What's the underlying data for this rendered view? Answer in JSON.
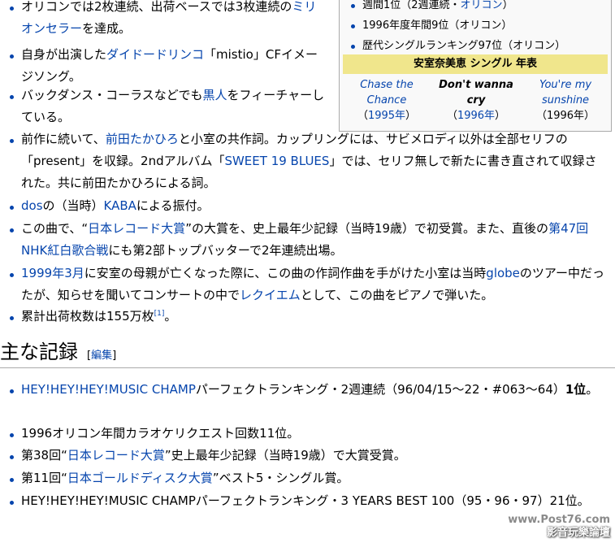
{
  "top_list": [
    {
      "parts": [
        {
          "t": "オリコンでは2枚連続、出荷ベースでは3枚連続の"
        },
        {
          "t": "ミリオンセラー",
          "link": true
        },
        {
          "t": "を達成。"
        }
      ]
    },
    {
      "parts": [
        {
          "t": "自身が出演した"
        },
        {
          "t": "ダイドードリンコ",
          "link": true
        },
        {
          "t": "「mistio」CFイメージソング。"
        }
      ]
    },
    {
      "parts": [
        {
          "t": "バックダンス・コーラスなどでも"
        },
        {
          "t": "黒人",
          "link": true
        },
        {
          "t": "をフィーチャーしている。"
        }
      ]
    },
    {
      "parts": [
        {
          "t": "前作に続いて、"
        },
        {
          "t": "前田たかひろ",
          "link": true
        },
        {
          "t": "と小室の共作詞。カップリングには、サビメロディ以外は全部セリフの「present」を収録。2ndアルバム「"
        },
        {
          "t": "SWEET 19 BLUES",
          "link": true
        },
        {
          "t": "」では、セリフ無しで新たに書き直されて収録された。共に前田たかひろによる詞。"
        }
      ]
    },
    {
      "parts": [
        {
          "t": "dos",
          "link": true
        },
        {
          "t": "の（当時）"
        },
        {
          "t": "KABA",
          "link": true
        },
        {
          "t": "による振付。"
        }
      ]
    },
    {
      "parts": [
        {
          "t": "この曲で、“"
        },
        {
          "t": "日本レコード大賞",
          "link": true
        },
        {
          "t": "”の大賞を、史上最年少記録（当時19歳）で初受賞。また、直後の"
        },
        {
          "t": "第47回NHK紅白歌合戦",
          "link": true
        },
        {
          "t": "にも第2部トップバッターで2年連続出場。"
        }
      ]
    },
    {
      "parts": [
        {
          "t": "1999年",
          "link": true
        },
        {
          "t": "3月",
          "link": true
        },
        {
          "t": "に安室の母親が亡くなった際に、この曲の作詞作曲を手がけた小室は当時"
        },
        {
          "t": "globe",
          "link": true
        },
        {
          "t": "のツアー中だったが、知らせを聞いてコンサートの中で"
        },
        {
          "t": "レクイエム",
          "link": true
        },
        {
          "t": "として、この曲をピアノで弾いた。"
        }
      ]
    },
    {
      "parts": [
        {
          "t": "累計出荷枚数は155万枚"
        },
        {
          "t": "[1]",
          "link": true,
          "sup": true
        },
        {
          "t": "。"
        }
      ]
    }
  ],
  "infobox": {
    "rows": [
      {
        "parts": [
          {
            "t": "週間1位（2週連続・"
          },
          {
            "t": "オリコン",
            "link": true
          },
          {
            "t": "）"
          }
        ]
      },
      {
        "parts": [
          {
            "t": "1996年度年間9位（オリコン）"
          }
        ]
      },
      {
        "parts": [
          {
            "t": "歴代シングルランキング97位（オリコン）"
          }
        ]
      }
    ],
    "chronology_title": "安室奈美恵 シングル 年表",
    "prev": {
      "title": "Chase the Chance",
      "year": "1995年"
    },
    "current": {
      "title": "Don't wanna cry",
      "year": "1996年"
    },
    "next": {
      "title": "You're my sunshine",
      "year": "1996年"
    }
  },
  "section": {
    "heading": "主な記録",
    "edit_open": "[",
    "edit_label": "編集",
    "edit_close": "]"
  },
  "records": [
    {
      "parts": [
        {
          "t": "HEY!HEY!HEY!MUSIC CHAMP",
          "link": true
        },
        {
          "t": "パーフェクトランキング・2週連続（96/04/15〜22・#063〜64）"
        },
        {
          "t": "1位",
          "bold": true
        },
        {
          "t": "。"
        }
      ]
    },
    {
      "parts": [
        {
          "t": "1996オリコン年間カラオケリクエスト回数11位。"
        }
      ]
    },
    {
      "parts": [
        {
          "t": "第38回“"
        },
        {
          "t": "日本レコード大賞",
          "link": true
        },
        {
          "t": "”史上最年少記録（当時19歳）で大賞受賞。"
        }
      ]
    },
    {
      "parts": [
        {
          "t": "第11回“"
        },
        {
          "t": "日本ゴールドディスク大賞",
          "link": true
        },
        {
          "t": "”ベスト5・シングル賞。"
        }
      ]
    },
    {
      "parts": [
        {
          "t": "HEY!HEY!HEY!MUSIC CHAMPパーフェクトランキング・3 YEARS BEST 100（95・96・97）21位。"
        }
      ]
    }
  ],
  "watermark": {
    "url": "www.Post76.com",
    "name": "影音玩樂論壇"
  }
}
